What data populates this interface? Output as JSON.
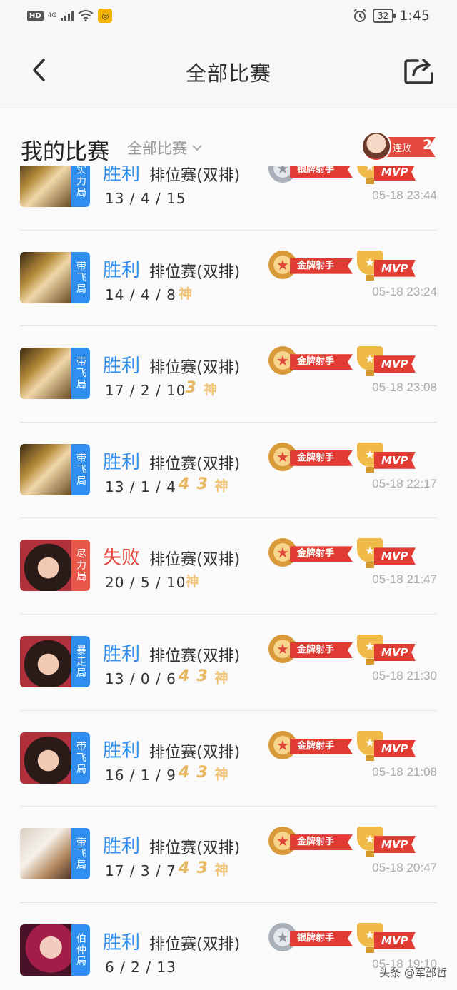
{
  "status_bar": {
    "badge": "HD",
    "network": "4G",
    "battery": "32",
    "time": "1:45"
  },
  "header": {
    "title": "全部比赛"
  },
  "section": {
    "title": "我的比赛",
    "filter_label": "全部比赛",
    "streak_label": "连败",
    "streak_count": "2"
  },
  "matches": [
    {
      "result": "胜利",
      "outcome": "win",
      "mode": "排位赛(双排)",
      "kda": "13 / 4 / 15",
      "tag": "实力局",
      "tag_color": "blue",
      "avatar": "gold",
      "medal": "银牌射手",
      "medal_type": "silver",
      "mvp": "MVP",
      "marks": [],
      "time": "05-18 23:44"
    },
    {
      "result": "胜利",
      "outcome": "win",
      "mode": "排位赛(双排)",
      "kda": "14 / 4 / 8",
      "tag": "带飞局",
      "tag_color": "blue",
      "avatar": "gold",
      "medal": "金牌射手",
      "medal_type": "gold",
      "mvp": "MVP",
      "marks": [
        "神"
      ],
      "time": "05-18 23:24"
    },
    {
      "result": "胜利",
      "outcome": "win",
      "mode": "排位赛(双排)",
      "kda": "17 / 2 / 10",
      "tag": "带飞局",
      "tag_color": "blue",
      "avatar": "gold",
      "medal": "金牌射手",
      "medal_type": "gold",
      "mvp": "MVP",
      "marks": [
        "3",
        "神"
      ],
      "time": "05-18 23:08"
    },
    {
      "result": "胜利",
      "outcome": "win",
      "mode": "排位赛(双排)",
      "kda": "13 / 1 / 4",
      "tag": "带飞局",
      "tag_color": "blue",
      "avatar": "gold",
      "medal": "金牌射手",
      "medal_type": "gold",
      "mvp": "MVP",
      "marks": [
        "4",
        "3",
        "神"
      ],
      "time": "05-18 22:17"
    },
    {
      "result": "失败",
      "outcome": "lose",
      "mode": "排位赛(双排)",
      "kda": "20 / 5 / 10",
      "tag": "尽力局",
      "tag_color": "red",
      "avatar": "dark",
      "medal": "金牌射手",
      "medal_type": "gold",
      "mvp": "MVP",
      "marks": [
        "神"
      ],
      "time": "05-18 21:47"
    },
    {
      "result": "胜利",
      "outcome": "win",
      "mode": "排位赛(双排)",
      "kda": "13 / 0 / 6",
      "tag": "暴走局",
      "tag_color": "blue",
      "avatar": "dark",
      "medal": "金牌射手",
      "medal_type": "gold",
      "mvp": "MVP",
      "marks": [
        "4",
        "3",
        "神"
      ],
      "time": "05-18 21:30"
    },
    {
      "result": "胜利",
      "outcome": "win",
      "mode": "排位赛(双排)",
      "kda": "16 / 1 / 9",
      "tag": "带飞局",
      "tag_color": "blue",
      "avatar": "dark",
      "medal": "金牌射手",
      "medal_type": "gold",
      "mvp": "MVP",
      "marks": [
        "4",
        "3",
        "神"
      ],
      "time": "05-18 21:08"
    },
    {
      "result": "胜利",
      "outcome": "win",
      "mode": "排位赛(双排)",
      "kda": "17 / 3 / 7",
      "tag": "带飞局",
      "tag_color": "blue",
      "avatar": "white",
      "medal": "金牌射手",
      "medal_type": "gold",
      "mvp": "MVP",
      "marks": [
        "4",
        "3",
        "神"
      ],
      "time": "05-18 20:47"
    },
    {
      "result": "胜利",
      "outcome": "win",
      "mode": "排位赛(双排)",
      "kda": "6 / 2 / 13",
      "tag": "伯仲局",
      "tag_color": "blue",
      "avatar": "pink",
      "medal": "银牌射手",
      "medal_type": "silver",
      "mvp": "MVP",
      "marks": [],
      "time": "05-18 19:10"
    }
  ],
  "watermark": "头条 @军部哲"
}
